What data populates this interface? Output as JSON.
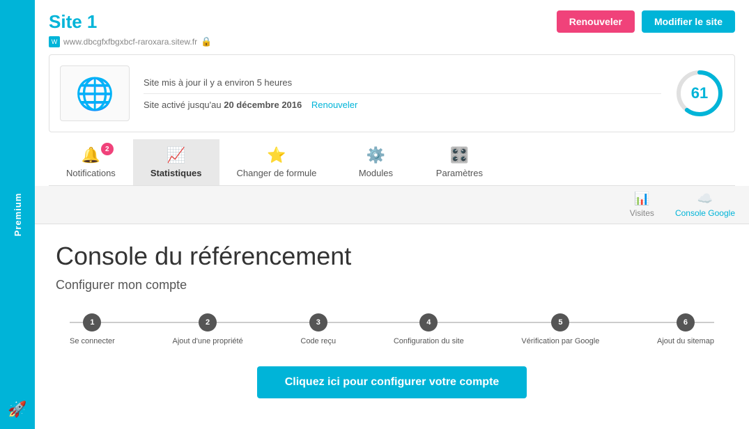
{
  "sidebar": {
    "premium_label": "Premium",
    "icon": "🚀"
  },
  "header": {
    "site_title": "Site 1",
    "site_url": "www.dbcgfxfbgxbcf-raroxara.sitew.fr",
    "btn_renew": "Renouveler",
    "btn_modify": "Modifier le site"
  },
  "site_info": {
    "update_status": "Site mis à jour il y a environ 5 heures",
    "active_until_prefix": "Site activé jusqu'au ",
    "active_until_date": "20 décembre 2016",
    "renew_link": "Renouveler",
    "score": "61"
  },
  "tabs": [
    {
      "id": "notifications",
      "label": "Notifications",
      "icon": "🔔",
      "badge": "2",
      "active": false
    },
    {
      "id": "statistiques",
      "label": "Statistiques",
      "icon": "📈",
      "badge": "",
      "active": true
    },
    {
      "id": "formule",
      "label": "Changer de formule",
      "icon": "⭐",
      "badge": "",
      "active": false
    },
    {
      "id": "modules",
      "label": "Modules",
      "icon": "⚙️",
      "badge": "",
      "active": false
    },
    {
      "id": "parametres",
      "label": "Paramètres",
      "icon": "🎛️",
      "badge": "",
      "active": false
    }
  ],
  "sub_tabs": [
    {
      "id": "visites",
      "label": "Visites",
      "icon": "📊",
      "active": false
    },
    {
      "id": "console_google",
      "label": "Console Google",
      "icon": "☁️",
      "active": true
    }
  ],
  "content": {
    "page_title": "Console du référencement",
    "page_subtitle": "Configurer mon compte"
  },
  "steps": [
    {
      "number": "1",
      "label": "Se connecter"
    },
    {
      "number": "2",
      "label": "Ajout d'une propriété"
    },
    {
      "number": "3",
      "label": "Code reçu"
    },
    {
      "number": "4",
      "label": "Configuration du site"
    },
    {
      "number": "5",
      "label": "Vérification par Google"
    },
    {
      "number": "6",
      "label": "Ajout du sitemap"
    }
  ],
  "cta": {
    "label": "Cliquez ici pour configurer votre compte"
  }
}
